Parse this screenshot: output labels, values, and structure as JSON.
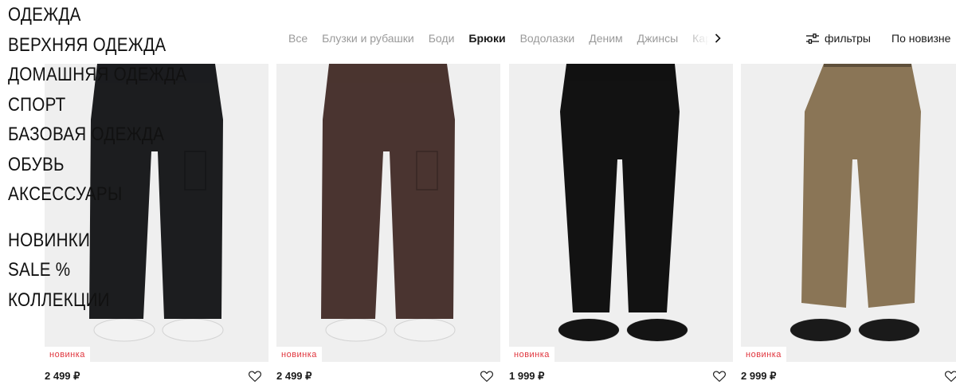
{
  "left_menu": {
    "main": [
      "ОДЕЖДА",
      "ВЕРХНЯЯ ОДЕЖДА",
      "ДОМАШНЯЯ ОДЕЖДА",
      "СПОРТ",
      "БАЗОВАЯ ОДЕЖДА",
      "ОБУВЬ",
      "АКСЕССУАРЫ"
    ],
    "extra": [
      "НОВИНКИ",
      "SALE %",
      "КОЛЛЕКЦИИ"
    ]
  },
  "categories": [
    {
      "label": "Все",
      "active": false
    },
    {
      "label": "Блузки и рубашки",
      "active": false
    },
    {
      "label": "Боди",
      "active": false
    },
    {
      "label": "Брюки",
      "active": true
    },
    {
      "label": "Водолазки",
      "active": false
    },
    {
      "label": "Деним",
      "active": false
    },
    {
      "label": "Джинсы",
      "active": false
    },
    {
      "label": "Кардиганы",
      "active": false
    }
  ],
  "toolbar": {
    "filters_label": "фильтры",
    "sort_label": "По новизне"
  },
  "products": [
    {
      "badge": "новинка",
      "price": "2 499 ₽",
      "pants_color": "#1c1d1f",
      "shoe_color": "#f2f2f2",
      "style": "cargo"
    },
    {
      "badge": "новинка",
      "price": "2 499 ₽",
      "pants_color": "#4a3430",
      "shoe_color": "#f2f2f2",
      "style": "cargo"
    },
    {
      "badge": "новинка",
      "price": "1 999 ₽",
      "pants_color": "#121212",
      "shoe_color": "#141414",
      "style": "straight"
    },
    {
      "badge": "новинка",
      "price": "2 999 ₽",
      "pants_color": "#8a7556",
      "shoe_color": "#1a1a1a",
      "style": "wide"
    }
  ],
  "colors": {
    "badge_text": "#e0343c",
    "muted_category": "#9a9a9a",
    "photo_bg": "#efefef"
  }
}
